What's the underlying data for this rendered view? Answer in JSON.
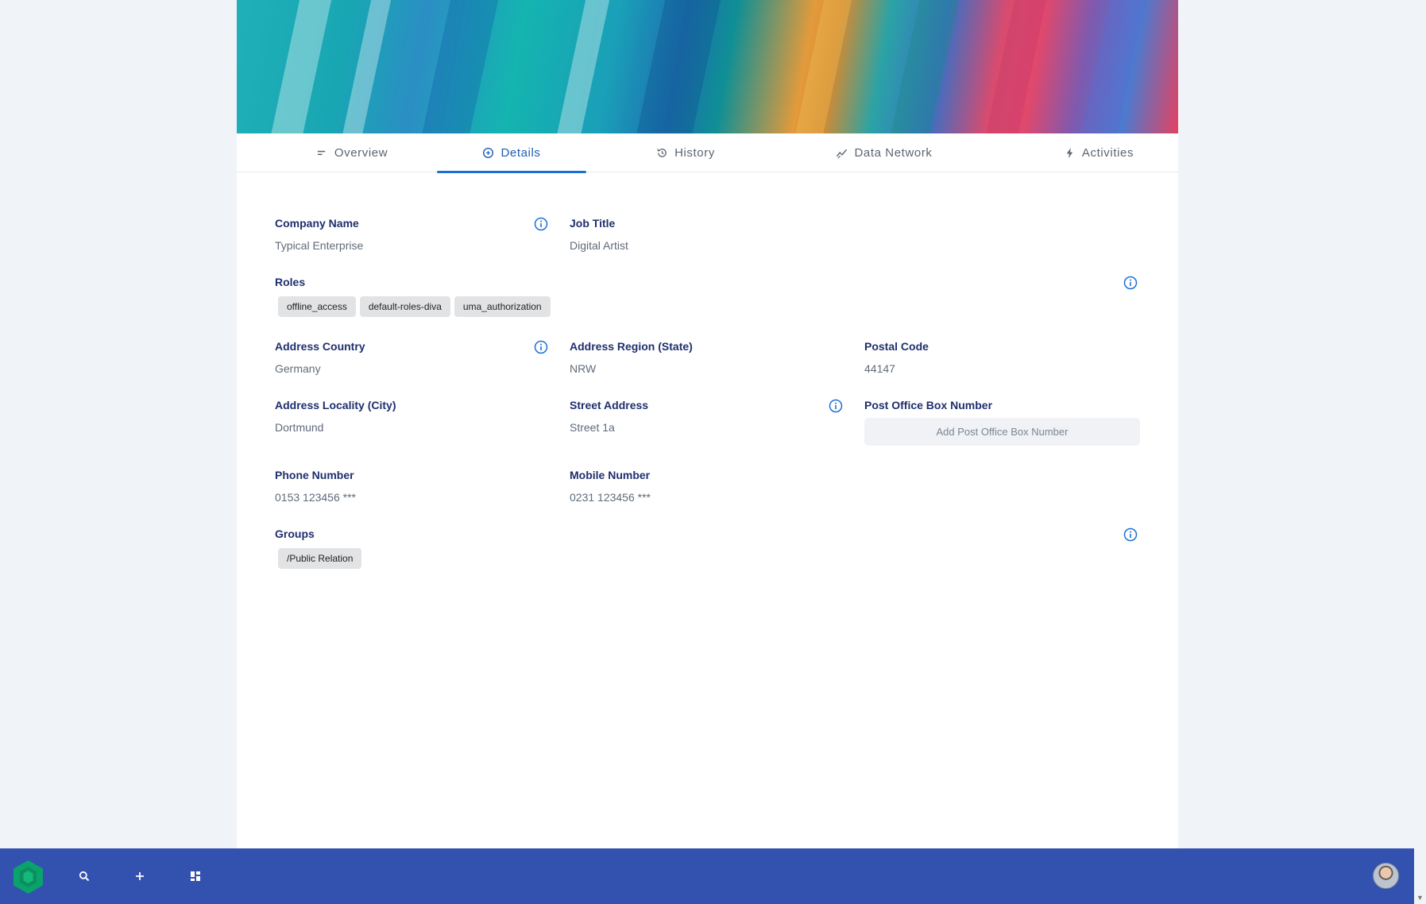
{
  "tabs": [
    {
      "label": "Overview",
      "icon": "lines-icon"
    },
    {
      "label": "Details",
      "icon": "details-icon",
      "active": true
    },
    {
      "label": "History",
      "icon": "history-icon"
    },
    {
      "label": "Data Network",
      "icon": "chart-icon"
    },
    {
      "label": "Activities",
      "icon": "bolt-icon"
    }
  ],
  "fields": {
    "company_name": {
      "label": "Company Name",
      "value": "Typical Enterprise"
    },
    "job_title": {
      "label": "Job Title",
      "value": "Digital Artist"
    },
    "roles": {
      "label": "Roles",
      "chips": [
        "offline_access",
        "default-roles-diva",
        "uma_authorization"
      ]
    },
    "address_country": {
      "label": "Address Country",
      "value": "Germany"
    },
    "address_region": {
      "label": "Address Region (State)",
      "value": "NRW"
    },
    "postal_code": {
      "label": "Postal Code",
      "value": "44147"
    },
    "address_locality": {
      "label": "Address Locality (City)",
      "value": "Dortmund"
    },
    "street_address": {
      "label": "Street Address",
      "value": "Street 1a"
    },
    "po_box": {
      "label": "Post Office Box Number",
      "placeholder": "Add Post Office Box Number"
    },
    "phone_number": {
      "label": "Phone Number",
      "value": "0153 123456 ***"
    },
    "mobile_number": {
      "label": "Mobile Number",
      "value": "0231 123456 ***"
    },
    "groups": {
      "label": "Groups",
      "chips": [
        "/Public Relation"
      ]
    }
  },
  "colors": {
    "accent": "#1d6fd6",
    "label": "#1f2f6e",
    "taskbar": "#3352b0",
    "logo": "#0aa36b"
  },
  "taskbar": {
    "icons": [
      "app-logo-icon",
      "search-icon",
      "plus-icon",
      "dashboard-icon",
      "avatar"
    ]
  }
}
